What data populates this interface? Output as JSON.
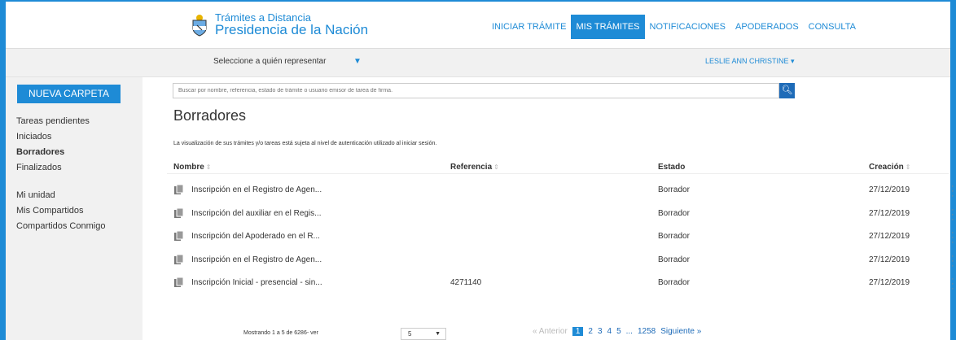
{
  "header": {
    "logo_line1": "Trámites a Distancia",
    "logo_line2": "Presidencia de la Nación",
    "nav": [
      "INICIAR TRÁMITE",
      "MIS TRÁMITES",
      "NOTIFICACIONES",
      "APODERADOS",
      "CONSULTA"
    ],
    "active_nav": "MIS TRÁMITES"
  },
  "subheader": {
    "represent_label": "Seleccione a quién representar",
    "represent_caret": "▼",
    "user_name": "LESLIE ANN CHRISTINE ▾"
  },
  "sidebar": {
    "new_folder": "NUEVA CARPETA",
    "items": [
      "Tareas pendientes",
      "Iniciados",
      "Borradores",
      "Finalizados"
    ],
    "items2": [
      "Mi unidad",
      "Mis Compartidos",
      "Compartidos Conmigo"
    ]
  },
  "search": {
    "placeholder": "Buscar por nombre, referencia, estado de trámite o usuario emisor de tarea de firma.",
    "icon": "search-icon"
  },
  "main": {
    "title": "Borradores",
    "notice": "La visualización de sus trámites y/o tareas está sujeta al nivel de autenticación utilizado al iniciar sesión."
  },
  "table": {
    "columns": [
      "Nombre",
      "Referencia",
      "Estado",
      "Creación"
    ],
    "rows": [
      {
        "name": "Inscripción en el Registro de Agen...",
        "ref": "",
        "estado": "Borrador",
        "fecha": "27/12/2019"
      },
      {
        "name": "Inscripción del auxiliar en el Regis...",
        "ref": "",
        "estado": "Borrador",
        "fecha": "27/12/2019"
      },
      {
        "name": "Inscripción del Apoderado en el R...",
        "ref": "",
        "estado": "Borrador",
        "fecha": "27/12/2019"
      },
      {
        "name": "Inscripción en el Registro de Agen...",
        "ref": "",
        "estado": "Borrador",
        "fecha": "27/12/2019"
      },
      {
        "name": "Inscripción Inicial - presencial - sin...",
        "ref": "4271140",
        "estado": "Borrador",
        "fecha": "27/12/2019"
      }
    ]
  },
  "footer": {
    "showing": "Mostrando 1 a 5 de 6286- ver",
    "per_page": "5",
    "prev": "« Anterior",
    "pages": [
      "1",
      "2",
      "3",
      "4",
      "5",
      "...",
      "1258"
    ],
    "next": "Siguiente »"
  }
}
